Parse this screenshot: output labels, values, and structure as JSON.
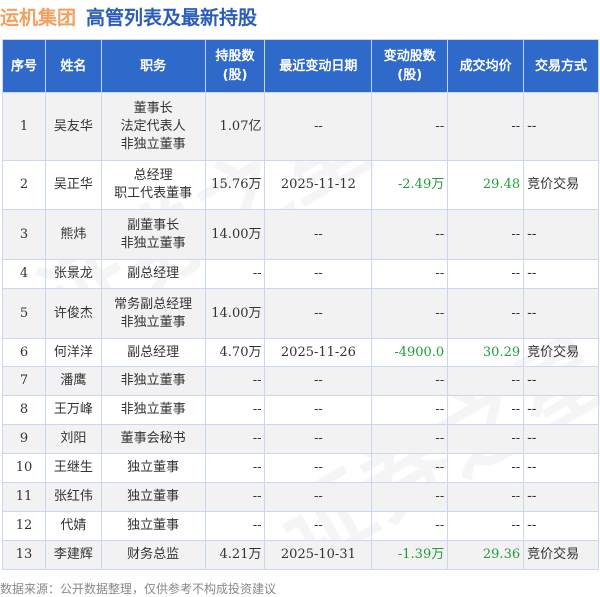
{
  "header": {
    "company": "运机集团",
    "title": "高管列表及最新持股"
  },
  "colors": {
    "header_bg": "#2f69c9",
    "company": "#f4a060",
    "title": "#2a5dbb",
    "change": "#1f9e3a"
  },
  "columns": [
    "序号",
    "姓名",
    "职务",
    "持股数\n(股)",
    "最近变动日期",
    "变动股数\n(股)",
    "成交均价",
    "交易方式"
  ],
  "rows": [
    {
      "no": "1",
      "name": "吴友华",
      "roles": [
        "董事长",
        "法定代表人",
        "非独立董事"
      ],
      "shares": "1.07亿",
      "date": "--",
      "change": "--",
      "price": "--",
      "method": "--"
    },
    {
      "no": "2",
      "name": "吴正华",
      "roles": [
        "总经理",
        "职工代表董事"
      ],
      "shares": "15.76万",
      "date": "2025-11-12",
      "change": "-2.49万",
      "price": "29.48",
      "method": "竞价交易"
    },
    {
      "no": "3",
      "name": "熊炜",
      "roles": [
        "副董事长",
        "非独立董事"
      ],
      "shares": "14.00万",
      "date": "--",
      "change": "--",
      "price": "--",
      "method": "--"
    },
    {
      "no": "4",
      "name": "张景龙",
      "roles": [
        "副总经理"
      ],
      "shares": "--",
      "date": "--",
      "change": "--",
      "price": "--",
      "method": "--"
    },
    {
      "no": "5",
      "name": "许俊杰",
      "roles": [
        "常务副总经理",
        "非独立董事"
      ],
      "shares": "14.00万",
      "date": "--",
      "change": "--",
      "price": "--",
      "method": "--"
    },
    {
      "no": "6",
      "name": "何洋洋",
      "roles": [
        "副总经理"
      ],
      "shares": "4.70万",
      "date": "2025-11-26",
      "change": "-4900.0",
      "price": "30.29",
      "method": "竞价交易"
    },
    {
      "no": "7",
      "name": "潘鹰",
      "roles": [
        "非独立董事"
      ],
      "shares": "--",
      "date": "--",
      "change": "--",
      "price": "--",
      "method": "--"
    },
    {
      "no": "8",
      "name": "王万峰",
      "roles": [
        "非独立董事"
      ],
      "shares": "--",
      "date": "--",
      "change": "--",
      "price": "--",
      "method": "--"
    },
    {
      "no": "9",
      "name": "刘阳",
      "roles": [
        "董事会秘书"
      ],
      "shares": "--",
      "date": "--",
      "change": "--",
      "price": "--",
      "method": "--"
    },
    {
      "no": "10",
      "name": "王继生",
      "roles": [
        "独立董事"
      ],
      "shares": "--",
      "date": "--",
      "change": "--",
      "price": "--",
      "method": "--"
    },
    {
      "no": "11",
      "name": "张红伟",
      "roles": [
        "独立董事"
      ],
      "shares": "--",
      "date": "--",
      "change": "--",
      "price": "--",
      "method": "--"
    },
    {
      "no": "12",
      "name": "代婧",
      "roles": [
        "独立董事"
      ],
      "shares": "--",
      "date": "--",
      "change": "--",
      "price": "--",
      "method": "--"
    },
    {
      "no": "13",
      "name": "李建辉",
      "roles": [
        "财务总监"
      ],
      "shares": "4.21万",
      "date": "2025-10-31",
      "change": "-1.39万",
      "price": "29.36",
      "method": "竞价交易"
    }
  ],
  "footer": "数据来源：公开数据整理，仅供参考不构成投资建议",
  "watermark": "证券之星"
}
